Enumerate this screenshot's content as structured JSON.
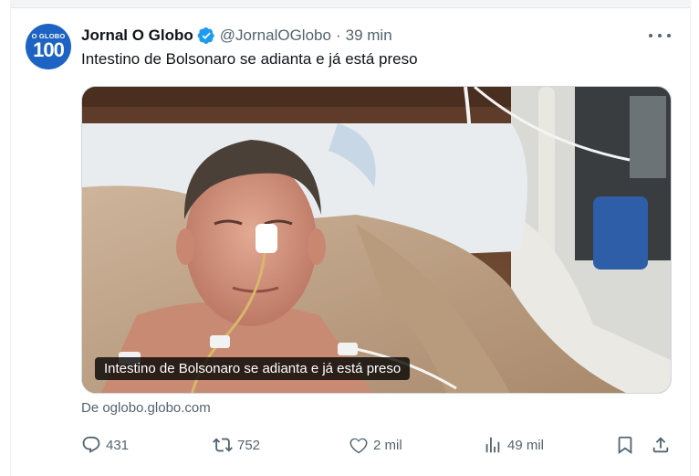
{
  "tweet": {
    "avatar_text_top": "O GLOBO",
    "avatar_text_num": "100",
    "display_name": "Jornal O Globo",
    "handle": "@JornalOGlobo",
    "separator": "·",
    "time": "39 min",
    "text": "Intestino de Bolsonaro se adianta e já está preso",
    "media_caption": "Intestino de Bolsonaro se adianta e já está preso",
    "source": "De oglobo.globo.com"
  },
  "actions": {
    "replies": "431",
    "reposts": "752",
    "likes": "2 mil",
    "views": "49 mil"
  },
  "icons": {
    "verified": "verified-badge-icon",
    "more": "more-options-icon",
    "reply": "reply-icon",
    "repost": "repost-icon",
    "like": "heart-icon",
    "views": "views-chart-icon",
    "bookmark": "bookmark-icon",
    "share": "share-icon"
  },
  "colors": {
    "verified": "#1d9bf0",
    "text_primary": "#0f1419",
    "text_secondary": "#536471",
    "avatar_bg": "#1d63c4"
  }
}
